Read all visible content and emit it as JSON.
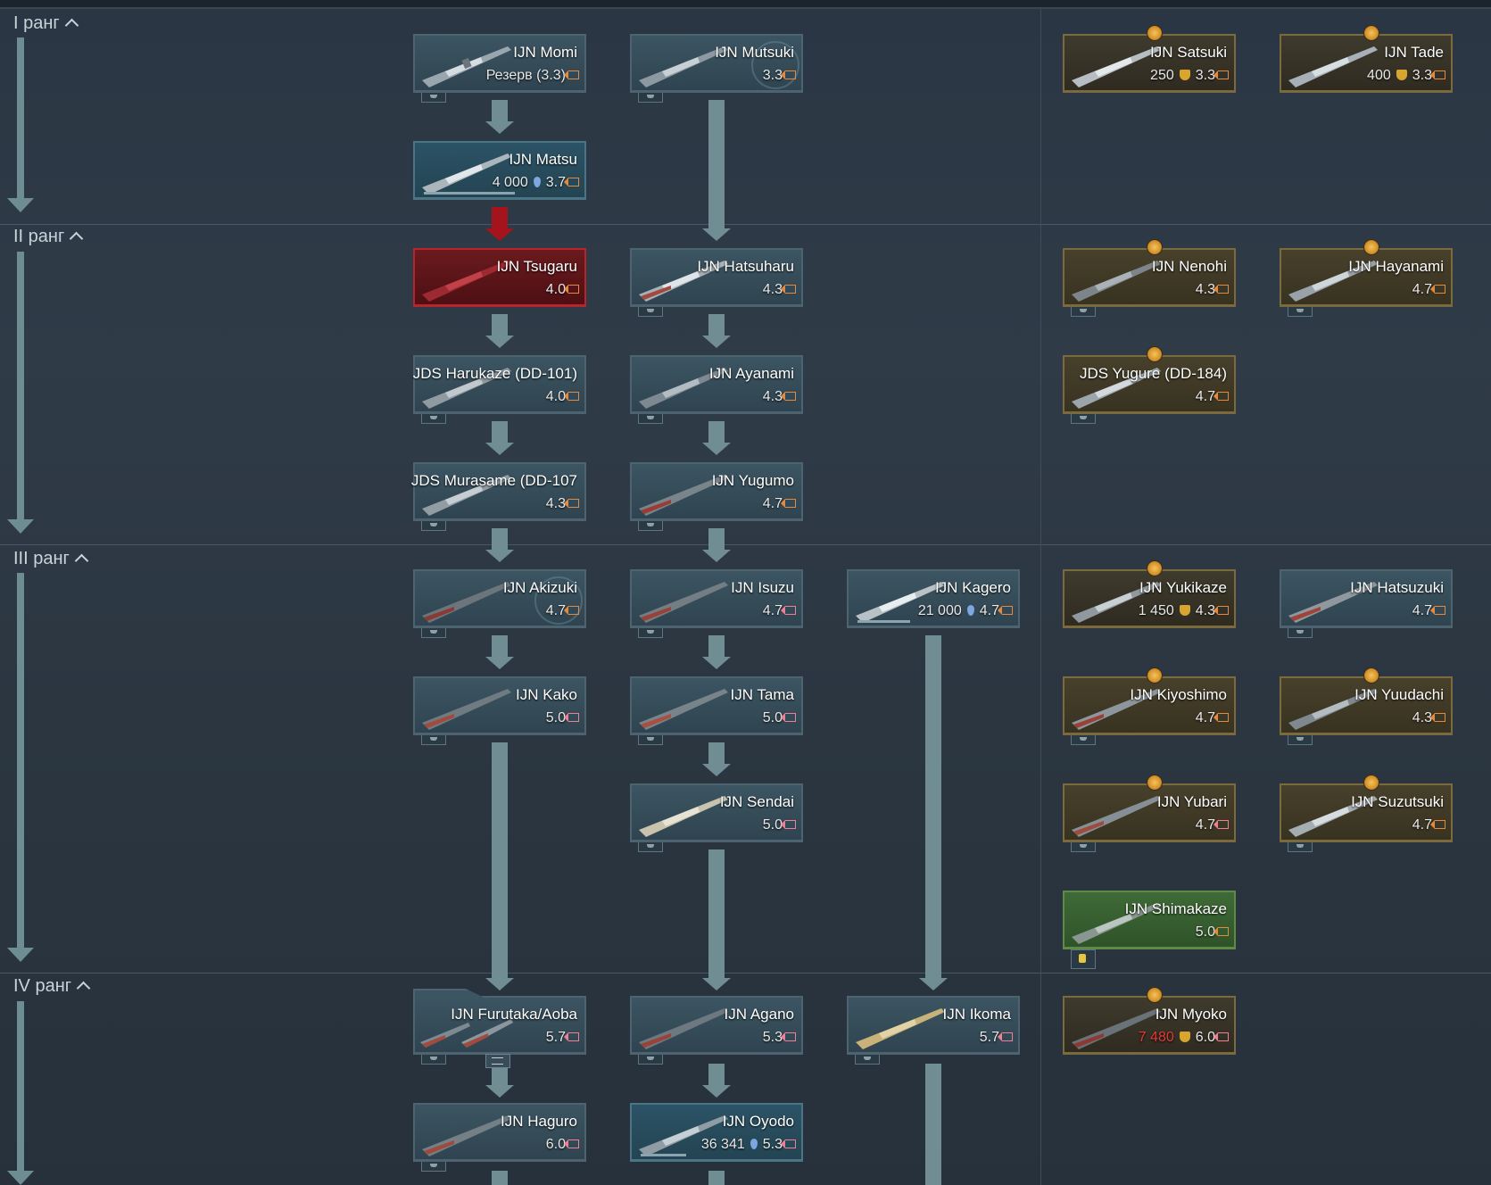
{
  "ranks": [
    {
      "label": "I ранг"
    },
    {
      "label": "II ранг"
    },
    {
      "label": "III ранг"
    },
    {
      "label": "IV ранг"
    }
  ],
  "vehicles": {
    "momi": {
      "name": "IJN Momi",
      "stat": "Резерв (3.3)"
    },
    "mutsuki": {
      "name": "IJN Mutsuki",
      "br": "3.3"
    },
    "satsuki": {
      "name": "IJN Satsuki",
      "cost": "250",
      "br": "3.3"
    },
    "tade": {
      "name": "IJN Tade",
      "cost": "400",
      "br": "3.3"
    },
    "matsu": {
      "name": "IJN Matsu",
      "cost": "4 000",
      "br": "3.7"
    },
    "tsugaru": {
      "name": "IJN Tsugaru",
      "br": "4.0"
    },
    "hatsuharu": {
      "name": "IJN Hatsuharu",
      "br": "4.3"
    },
    "nenohi": {
      "name": "IJN Nenohi",
      "br": "4.3"
    },
    "hayanami": {
      "name": "IJN Hayanami",
      "br": "4.7"
    },
    "harukaze": {
      "name": "JDS Harukaze (DD-101)",
      "br": "4.0"
    },
    "ayanami": {
      "name": "IJN Ayanami",
      "br": "4.3"
    },
    "yugure": {
      "name": "JDS Yugure (DD-184)",
      "br": "4.7"
    },
    "murasame": {
      "name": "JDS Murasame (DD-107",
      "br": "4.3"
    },
    "yugumo": {
      "name": "IJN Yugumo",
      "br": "4.7"
    },
    "akizuki": {
      "name": "IJN Akizuki",
      "br": "4.7"
    },
    "isuzu": {
      "name": "IJN Isuzu",
      "br": "4.7"
    },
    "kagero": {
      "name": "IJN Kagero",
      "cost": "21 000",
      "br": "4.7"
    },
    "yukikaze": {
      "name": "IJN Yukikaze",
      "cost": "1 450",
      "br": "4.3"
    },
    "hatsuzuki": {
      "name": "IJN Hatsuzuki",
      "br": "4.7"
    },
    "kako": {
      "name": "IJN Kako",
      "br": "5.0"
    },
    "tama": {
      "name": "IJN Tama",
      "br": "5.0"
    },
    "kiyoshimo": {
      "name": "IJN Kiyoshimo",
      "br": "4.7"
    },
    "yuudachi": {
      "name": "IJN Yuudachi",
      "br": "4.3"
    },
    "sendai": {
      "name": "IJN Sendai",
      "br": "5.0"
    },
    "yubari": {
      "name": "IJN Yubari",
      "br": "4.7"
    },
    "suzutsuki": {
      "name": "IJN Suzutsuki",
      "br": "4.7"
    },
    "shimakaze": {
      "name": "IJN Shimakaze",
      "br": "5.0"
    },
    "furutaka": {
      "name": "IJN Furutaka/Aoba",
      "br": "5.7"
    },
    "agano": {
      "name": "IJN Agano",
      "br": "5.3"
    },
    "ikoma": {
      "name": "IJN Ikoma",
      "br": "5.7"
    },
    "myoko": {
      "name": "IJN Myoko",
      "cost": "7 480",
      "br": "6.0"
    },
    "haguro": {
      "name": "IJN Haguro",
      "br": "6.0"
    },
    "oyodo": {
      "name": "IJN Oyodo",
      "cost": "36 341",
      "br": "5.3"
    }
  },
  "research_progress": {
    "matsu": 0.6,
    "kagero": 0.35,
    "oyodo": 0.3
  },
  "colors": {
    "line": "#6f8d92",
    "line_red": "#a5141c",
    "premium_border": "#7a6a3e",
    "squadron_green": "#3f6a37",
    "br_icon": "#e58a3c"
  }
}
